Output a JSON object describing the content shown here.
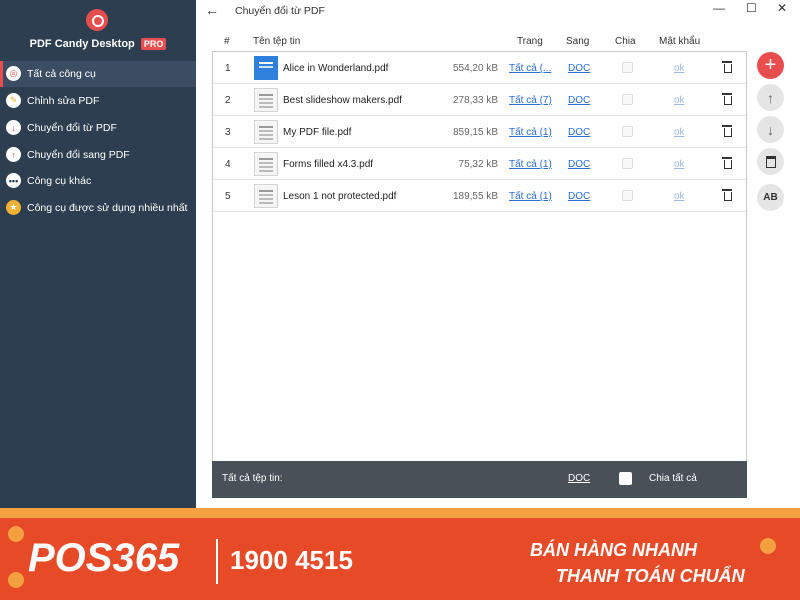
{
  "sidebar": {
    "app_name": "PDF Candy Desktop",
    "pro_badge": "PRO",
    "items": [
      {
        "label": "Tất cả công cụ",
        "icon": "spiral-icon",
        "color": "#e94e4e"
      },
      {
        "label": "Chỉnh sửa PDF",
        "icon": "edit-pen-icon",
        "color": "#f2b134"
      },
      {
        "label": "Chuyển đổi từ PDF",
        "icon": "arrow-down-icon",
        "color": "#e94e4e"
      },
      {
        "label": "Chuyển đổi sang PDF",
        "icon": "arrow-up-icon",
        "color": "#e94e4e"
      },
      {
        "label": "Công cụ khác",
        "icon": "more-dots-icon",
        "color": "#ffffff"
      },
      {
        "label": "Công cụ được sử dụng nhiều nhất",
        "icon": "star-icon",
        "color": "#f2b134"
      }
    ]
  },
  "titlebar": {
    "back_icon": "←",
    "title": "Chuyển đổi từ PDF",
    "min_icon": "—",
    "max_icon": "☐",
    "close_icon": "✕"
  },
  "table": {
    "headers": {
      "num": "#",
      "name": "Tên tệp tin",
      "pages": "Trang",
      "to": "Sang",
      "split": "Chia",
      "password": "Mật khẩu"
    },
    "rows": [
      {
        "num": "1",
        "name": "Alice in Wonderland.pdf",
        "size": "554,20 kB",
        "pages": "Tất cả (...",
        "format": "DOC",
        "password": "ok"
      },
      {
        "num": "2",
        "name": "Best slideshow makers.pdf",
        "size": "278,33 kB",
        "pages": "Tất cả (7)",
        "format": "DOC",
        "password": "ok"
      },
      {
        "num": "3",
        "name": "My PDF file.pdf",
        "size": "859,15 kB",
        "pages": "Tất cả (1)",
        "format": "DOC",
        "password": "ok"
      },
      {
        "num": "4",
        "name": "Forms filled x4.3.pdf",
        "size": "75,32 kB",
        "pages": "Tất cả (1)",
        "format": "DOC",
        "password": "ok"
      },
      {
        "num": "5",
        "name": "Leson 1 not protected.pdf",
        "size": "189,55 kB",
        "pages": "Tất cả (1)",
        "format": "DOC",
        "password": "ok"
      }
    ]
  },
  "footer": {
    "all_files": "Tất cả tệp tin:",
    "format": "DOC",
    "split_all": "Chia tất cả"
  },
  "tools": {
    "add": "+",
    "up": "↑",
    "down": "↓",
    "rename": "AB"
  },
  "banner": {
    "brand": "POS365",
    "phone": "1900 4515",
    "slogan_line1": "BÁN HÀNG NHANH",
    "slogan_line2": "THANH TOÁN CHUẨN",
    "colors": {
      "background": "#e64a27",
      "accent": "#f4a040"
    }
  }
}
